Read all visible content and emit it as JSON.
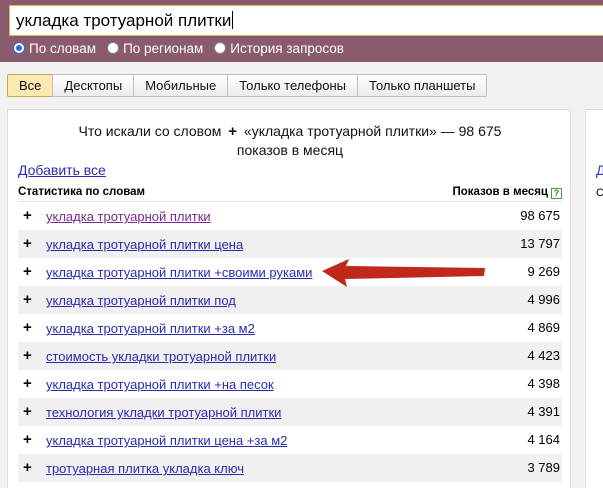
{
  "search": {
    "query": "укладка тротуарной плитки"
  },
  "radios": [
    {
      "label": "По словам",
      "checked": true
    },
    {
      "label": "По регионам",
      "checked": false
    },
    {
      "label": "История запросов",
      "checked": false
    }
  ],
  "tabs": [
    {
      "label": "Все",
      "active": true
    },
    {
      "label": "Десктопы",
      "active": false
    },
    {
      "label": "Мобильные",
      "active": false
    },
    {
      "label": "Только телефоны",
      "active": false
    },
    {
      "label": "Только планшеты",
      "active": false
    }
  ],
  "summary": {
    "prefix": "Что искали со словом",
    "plus": "+",
    "phrase": "«укладка тротуарной плитки» — 98 675",
    "suffix": "показов в месяц"
  },
  "add_all": "Добавить все",
  "table": {
    "col_words": "Статистика по словам",
    "col_shows": "Показов в месяц",
    "help": "?",
    "rows": [
      {
        "phrase": "укладка тротуарной плитки",
        "count": "98 675"
      },
      {
        "phrase": "укладка тротуарной плитки цена",
        "count": "13 797"
      },
      {
        "phrase": "укладка тротуарной плитки +своими руками",
        "count": "9 269"
      },
      {
        "phrase": "укладка тротуарной плитки под",
        "count": "4 996"
      },
      {
        "phrase": "укладка тротуарной плитки +за м2",
        "count": "4 869"
      },
      {
        "phrase": "стоимость укладки тротуарной плитки",
        "count": "4 423"
      },
      {
        "phrase": "укладка тротуарной плитки +на песок",
        "count": "4 398"
      },
      {
        "phrase": "технология укладки тротуарной плитки",
        "count": "4 391"
      },
      {
        "phrase": "укладка тротуарной плитки цена +за м2",
        "count": "4 164"
      },
      {
        "phrase": "тротуарная плитка укладка ключ",
        "count": "3 789"
      }
    ]
  },
  "right_panel": {
    "link_fragment": "Д",
    "text_fragment": "С"
  },
  "colors": {
    "header_bg": "#8a5a6d",
    "link": "#2b2bb0",
    "arrow": "#c0281c",
    "active_tab": "#fbe9b0"
  }
}
